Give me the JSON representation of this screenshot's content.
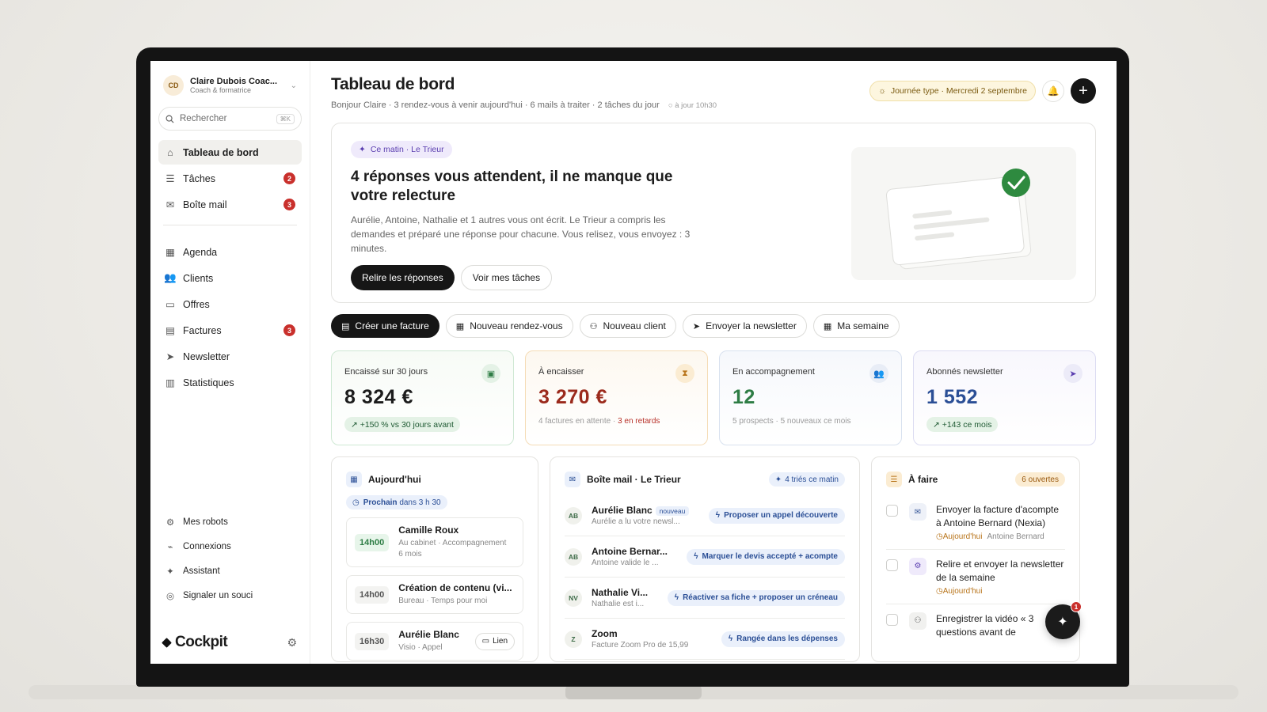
{
  "account": {
    "initials": "CD",
    "name": "Claire Dubois Coac...",
    "role": "Coach & formatrice"
  },
  "search": {
    "placeholder": "Rechercher",
    "shortcut": "⌘K"
  },
  "nav_primary": [
    {
      "label": "Tableau de bord",
      "icon": "home-icon",
      "badge": ""
    },
    {
      "label": "Tâches",
      "icon": "list-icon",
      "badge": "2"
    },
    {
      "label": "Boîte mail",
      "icon": "mail-icon",
      "badge": "3"
    }
  ],
  "nav_secondary": [
    {
      "label": "Agenda",
      "icon": "calendar-icon",
      "badge": ""
    },
    {
      "label": "Clients",
      "icon": "users-icon",
      "badge": ""
    },
    {
      "label": "Offres",
      "icon": "briefcase-icon",
      "badge": ""
    },
    {
      "label": "Factures",
      "icon": "file-icon",
      "badge": "3"
    },
    {
      "label": "Newsletter",
      "icon": "send-icon",
      "badge": ""
    },
    {
      "label": "Statistiques",
      "icon": "chart-icon",
      "badge": ""
    }
  ],
  "nav_bottom": [
    {
      "label": "Mes robots",
      "icon": "robot-icon"
    },
    {
      "label": "Connexions",
      "icon": "plug-icon"
    },
    {
      "label": "Assistant",
      "icon": "sparkles-icon"
    },
    {
      "label": "Signaler un souci",
      "icon": "headset-icon"
    }
  ],
  "brand": {
    "name": "Cockpit"
  },
  "header": {
    "title": "Tableau de bord",
    "subtitle": "Bonjour Claire · 3 rendez-vous à venir aujourd'hui · 6 mails à traiter · 2 tâches du jour",
    "updated": "○ à jour 10h30",
    "day_pill": "Journée type · Mercredi 2 septembre"
  },
  "hero": {
    "chip": "Ce matin · Le Trieur",
    "title": "4 réponses vous attendent, il ne manque que votre relecture",
    "description": "Aurélie, Antoine, Nathalie et 1 autres vous ont écrit. Le Trieur a compris les demandes et préparé une réponse pour chacune. Vous relisez, vous envoyez : 3 minutes.",
    "primary_button": "Relire les réponses",
    "secondary_button": "Voir mes tâches"
  },
  "quick_actions": [
    {
      "label": "Créer une facture",
      "icon": "invoice-icon"
    },
    {
      "label": "Nouveau rendez-vous",
      "icon": "calendar-icon"
    },
    {
      "label": "Nouveau client",
      "icon": "user-plus-icon"
    },
    {
      "label": "Envoyer la newsletter",
      "icon": "send-icon"
    },
    {
      "label": "Ma semaine",
      "icon": "calendar-icon"
    }
  ],
  "kpis": [
    {
      "label": "Encaissé sur 30 jours",
      "value": "8 324 €",
      "pill": "↗ +150 % vs 30 jours avant",
      "note": "",
      "note_alert": "",
      "color": "#1f5a33"
    },
    {
      "label": "À encaisser",
      "value": "3 270 €",
      "pill": "",
      "note": "4 factures en attente · ",
      "note_alert": "3 en retards",
      "color": "#9b2a1c"
    },
    {
      "label": "En accompagnement",
      "value": "12",
      "pill": "",
      "note": "5 prospects · 5 nouveaux ce mois",
      "note_alert": "",
      "color": "#2e7d45"
    },
    {
      "label": "Abonnés newsletter",
      "value": "1 552",
      "pill": "↗ +143 ce mois",
      "note": "",
      "note_alert": "",
      "color": "#2b4f96"
    }
  ],
  "today": {
    "title": "Aujourd'hui",
    "next_label": "Prochain",
    "next_value": "dans 3 h 30",
    "events": [
      {
        "time": "14h00",
        "title": "Camille Roux",
        "sub": "Au cabinet · Accompagnement 6 mois"
      },
      {
        "time": "14h00",
        "title": "Création de contenu (vi...",
        "sub": "Bureau · Temps pour moi"
      },
      {
        "time": "16h30",
        "title": "Aurélie Blanc",
        "sub": "Visio · Appel",
        "link": "Lien"
      }
    ]
  },
  "inbox": {
    "title": "Boîte mail · Le Trieur",
    "tag": "4 triés ce matin",
    "mails": [
      {
        "initials": "AB",
        "name": "Aurélie Blanc",
        "badge": "nouveau",
        "snippet": "Aurélie a lu votre newsl...",
        "action": "Proposer un appel découverte"
      },
      {
        "initials": "AB",
        "name": "Antoine Bernar...",
        "badge": "",
        "snippet": "Antoine valide le ...",
        "action": "Marquer le devis accepté + acompte"
      },
      {
        "initials": "NV",
        "name": "Nathalie Vi...",
        "badge": "",
        "snippet": "Nathalie est i...",
        "action": "Réactiver sa fiche + proposer un créneau"
      },
      {
        "initials": "Z",
        "name": "Zoom",
        "badge": "",
        "snippet": "Facture Zoom Pro de 15,99",
        "action": "Rangée dans les dépenses"
      }
    ]
  },
  "todo": {
    "title": "À faire",
    "tag": "6 ouvertes",
    "items": [
      {
        "text": "Envoyer la facture d'acompte à Antoine Bernard (Nexia)",
        "due": "Aujourd'hui",
        "who": "Antoine Bernard",
        "icon": "mail-icon"
      },
      {
        "text": "Relire et envoyer la newsletter de la semaine",
        "due": "Aujourd'hui",
        "who": "",
        "icon": "robot-icon"
      },
      {
        "text": "Enregistrer la vidéo « 3 questions avant de",
        "due": "",
        "who": "",
        "icon": "user-icon"
      }
    ]
  },
  "fab": {
    "badge": "1",
    "icon": "sparkles-icon"
  }
}
